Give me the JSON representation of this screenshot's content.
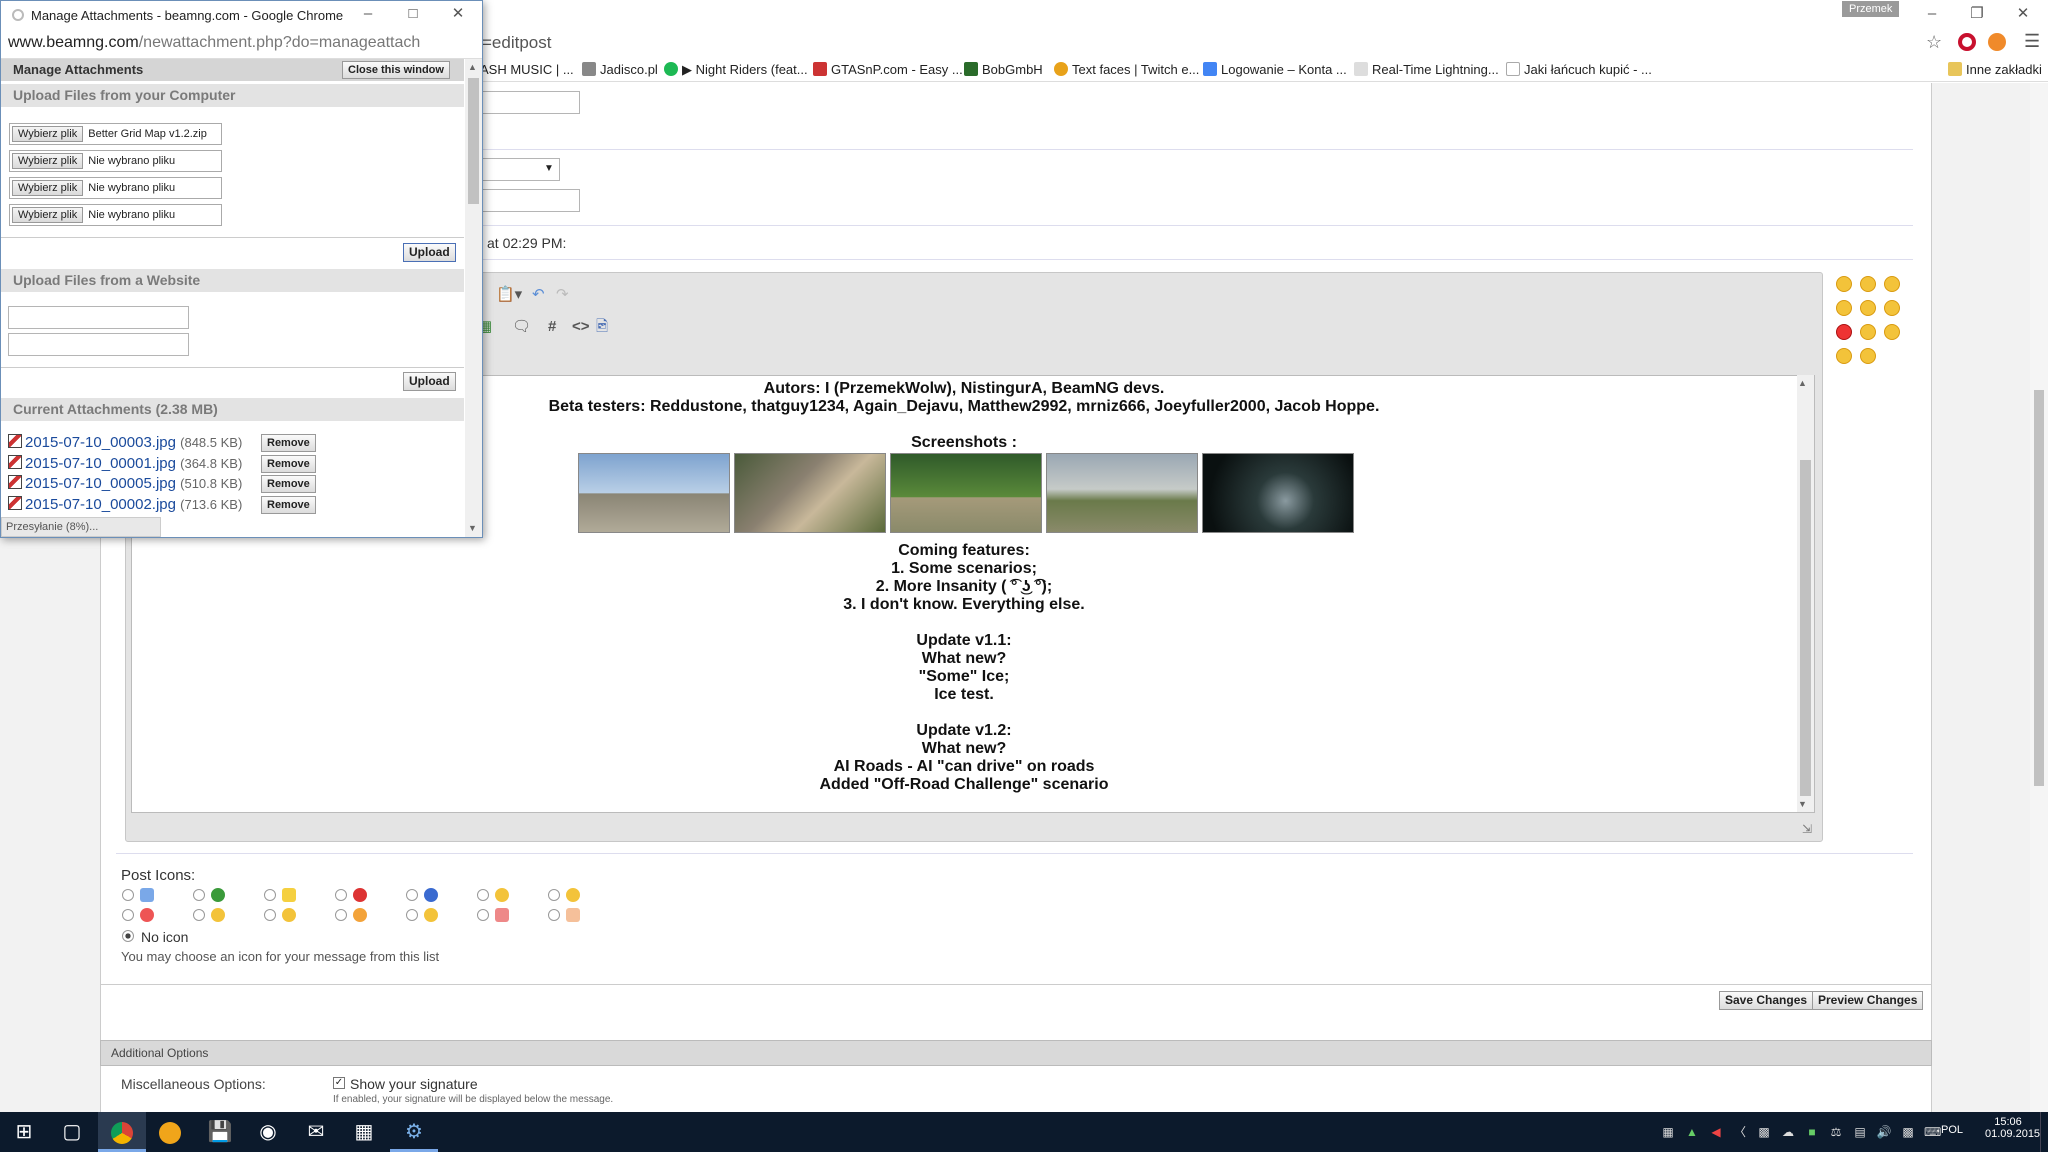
{
  "browser": {
    "user_name": "Przemek",
    "address_suffix": "=editpost",
    "bookmarks": [
      "ASH MUSIC | ...",
      "Jadisco.pl",
      "Night Riders (feat...",
      "GTASnP.com - Easy ...",
      "BobGmbH",
      "Text faces | Twitch e...",
      "Logowanie – Konta ...",
      "Real-Time Lightning...",
      "Jaki łańcuch kupić - ..."
    ],
    "other_bookmarks": "Inne zakładki"
  },
  "form": {
    "timestamp_text": "at 02:29 PM:"
  },
  "editor": {
    "lines": [
      "Autors: I (PrzemekWolw), NistingurA, BeamNG devs.",
      "Beta testers: Reddustone, thatguy1234, Again_Dejavu, Matthew2992, mrniz666, Joeyfuller2000, Jacob Hoppe.",
      "",
      "Screenshots :",
      "",
      "",
      "",
      "",
      "",
      "",
      "Coming features:",
      "1. Some scenarios;",
      "2. More Insanity ( ͡° ͜ʖ ͡°);",
      "3. I don't know. Everything else.",
      "",
      "Update v1.1:",
      "What new?",
      "\"Some\" Ice;",
      "Ice test.",
      "",
      "Update v1.2:",
      "What new?",
      "AI Roads - AI \"can drive\" on roads",
      "Added \"Off-Road Challenge\" scenario"
    ]
  },
  "post_icons": {
    "title": "Post Icons:",
    "no_icon_label": "No icon",
    "hint": "You may choose an icon for your message from this list"
  },
  "actions": {
    "save": "Save Changes",
    "preview": "Preview Changes"
  },
  "additional": {
    "title": "Additional Options",
    "misc_label": "Miscellaneous Options:",
    "show_signature": "Show your signature",
    "signature_hint": "If enabled, your signature will be displayed below the message."
  },
  "popup": {
    "window_title": "Manage Attachments - beamng.com - Google Chrome",
    "url_host": "www.beamng.com",
    "url_path": "/newattachment.php?do=manageattach",
    "header": "Manage Attachments",
    "close_button": "Close this window",
    "upload_computer_title": "Upload Files from your Computer",
    "choose_label": "Wybierz plik",
    "files": [
      "Better Grid Map v1.2.zip",
      "Nie wybrano pliku",
      "Nie wybrano pliku",
      "Nie wybrano pliku"
    ],
    "upload_label": "Upload",
    "upload_website_title": "Upload Files from a Website",
    "current_title": "Current Attachments (2.38 MB)",
    "attachments": [
      {
        "name": "2015-07-10_00003.jpg",
        "size": "(848.5 KB)"
      },
      {
        "name": "2015-07-10_00001.jpg",
        "size": "(364.8 KB)"
      },
      {
        "name": "2015-07-10_00005.jpg",
        "size": "(510.8 KB)"
      },
      {
        "name": "2015-07-10_00002.jpg",
        "size": "(713.6 KB)"
      }
    ],
    "remove_label": "Remove",
    "status": "Przesyłanie (8%)..."
  },
  "taskbar": {
    "language": "POL",
    "time": "15:06",
    "date": "01.09.2015"
  },
  "colors": {
    "accent": "#1a4a9c",
    "taskbar": "#0c1a2c"
  }
}
